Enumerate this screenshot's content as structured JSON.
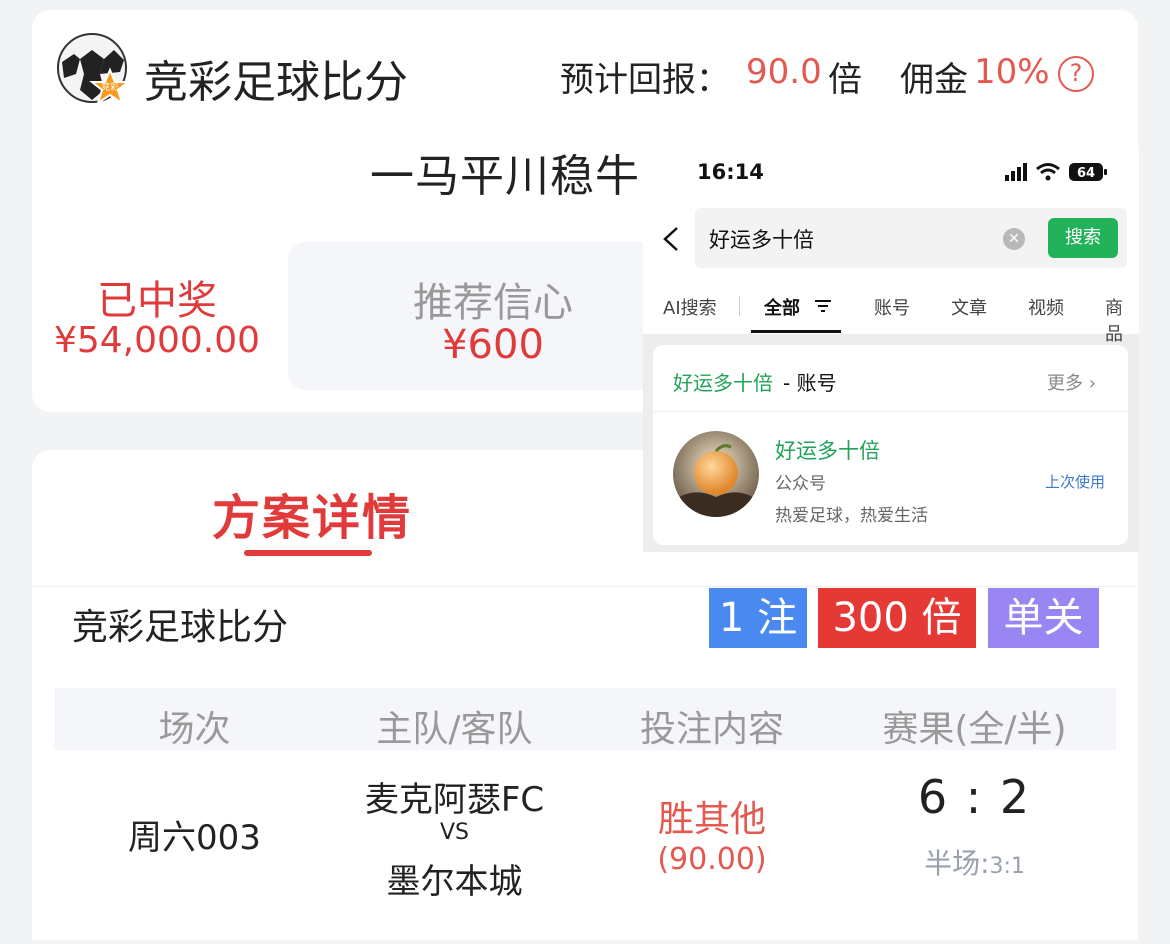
{
  "header": {
    "app_title": "竞彩足球比分",
    "return_label": "预计回报：",
    "return_value": "90.0",
    "return_unit": "倍",
    "commission_label": "佣金",
    "commission_value": "10%",
    "help_symbol": "?"
  },
  "plan": {
    "author": "一马平川稳牛",
    "won_label": "已中奖",
    "won_amount": "¥54,000.00",
    "confidence_label": "推荐信心",
    "confidence_value": "¥600"
  },
  "details": {
    "tab_title": "方案详情",
    "game_name": "竞彩足球比分",
    "tags": {
      "notes": "1 注",
      "multiple": "300 倍",
      "pass_type": "单关"
    },
    "table": {
      "headers": [
        "场次",
        "主队/客队",
        "投注内容",
        "赛果(全/半)"
      ],
      "row": {
        "session": "周六003",
        "home_team": "麦克阿瑟FC",
        "vs": "VS",
        "away_team": "墨尔本城",
        "bet": "胜其他",
        "odds": "(90.00)",
        "score": "6 : 2",
        "half_label": "半场:",
        "half_score": "3:1"
      }
    }
  },
  "overlay": {
    "status_time": "16:14",
    "battery": "64",
    "search_query": "好运多十倍",
    "search_button": "搜索",
    "tabs": [
      "AI搜索",
      "全部",
      "账号",
      "文章",
      "视频",
      "商品"
    ],
    "result_header_name": "好运多十倍",
    "result_header_suffix": " - 账号",
    "more_label": "更多",
    "account_name": "好运多十倍",
    "account_type": "公众号",
    "account_bio": "热爱足球，热爱生活",
    "last_used": "上次使用"
  },
  "colors": {
    "red": "#e03a3a",
    "orange_red": "#e5584f",
    "blue_tag": "#4a89f0",
    "purple_tag": "#9a86f2",
    "green": "#22b35a"
  }
}
